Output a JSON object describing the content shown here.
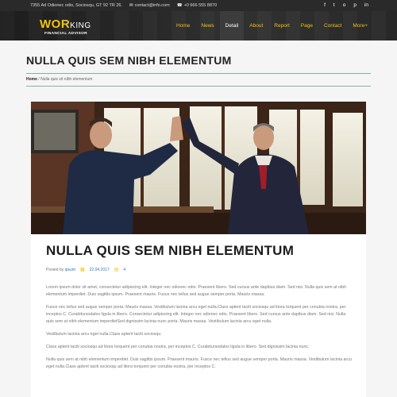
{
  "topbar": {
    "address": "7355 Ad Odionec odio, Sociosqu, GT 92 TR 26.",
    "email": "contact@info.com",
    "phone": "+0 666 555 8870",
    "social": [
      "f",
      "t",
      "o",
      "p",
      "in"
    ]
  },
  "logo": {
    "big": "WOR",
    "small": "KING",
    "tagline": "FINANCIAL ADVISOR"
  },
  "nav": [
    "Home",
    "News",
    "Detail",
    "About",
    "Report",
    "Page",
    "Contact",
    "More+"
  ],
  "page": {
    "title": "NULLA QUIS SEM NIBH ELEMENTUM",
    "breadcrumb_home": "Home",
    "breadcrumb_current": " / Nulla quis sit nibh elementum"
  },
  "article": {
    "title": "NULLA QUIS SEM NIBH ELEMENTUM",
    "posted_by_label": "Posted by",
    "author": "ipsum",
    "date": "22.04.2017",
    "comments": "4",
    "paragraphs": [
      "Lorem ipsum dolor sit amet, consectetur adipiscing elit. Integer nec odionec odio. Praesent libero. Sed cursus ante dapibus diam. Sed nisi. Nulla quis sem at nibh elementum imperdiet. Duis sagittis ipsum. Praesent mauris. Fusce nec tellus sed augue semper porta. Mauris massa.",
      "Fusce nec tellus sed augue semper porta. Mauris massa. Vestibulum lacinia arcu eget nulla.Class aptent taciti sociosqu ad litora torquent per conubia nostra, per inceptos C. Curabitursodales ligula in libero. Consectetur adipiscing elit. Integer nec odionec odio. Praesent libero. Sed cursus ante dapibus diam. Sed nisi. Nulla quis sem at nibh elementum imperdietSed dignissim lacinia nunc porta. Mauris massa. Vestibulum lacinia arcu eget nulla.",
      "Vestibulum lacinia arcu eget nulla.Class aptent taciti sociosqu.",
      "Class aptent taciti sociosqu ad litora torquent per conubia nostra, per inceptos C. Curabitursodales ligula in libero. Sed dignissim lacinia nunc.",
      "Nulla quis sem at nibh elementum imperdiet. Duis sagittis ipsum. Praesent mauris. Fusce nec tellus sed augue semper porta. Mauris massa. Vestibulum lacinia arcu eget nulla.Class aptent taciti sociosqu ad litora torquent per conubia nostra, per inceptos C."
    ]
  },
  "colors": {
    "accent": "#f2c40c",
    "header": "#2a2a2a",
    "rule": "#7fb3a8",
    "link": "#2a7ab8"
  }
}
